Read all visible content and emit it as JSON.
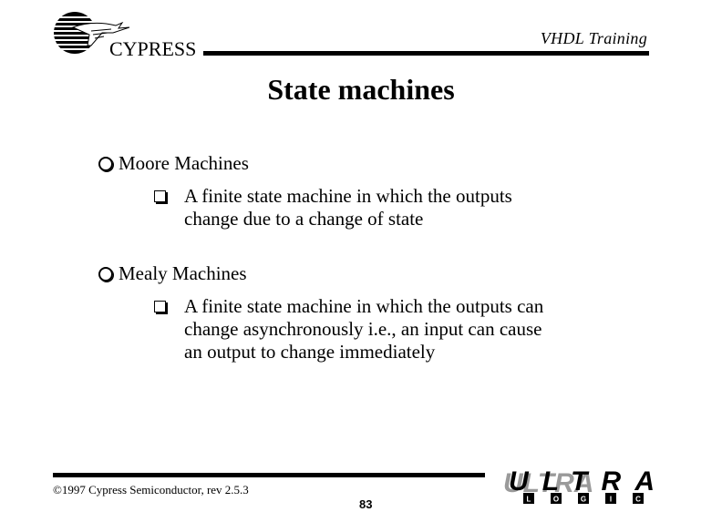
{
  "header": {
    "company_logo": "Cypress",
    "company_name": "CYPRESS",
    "title": "VHDL Training"
  },
  "slide": {
    "title": "State machines",
    "bullets": [
      {
        "label": "Moore Machines",
        "icon": "hollow-circle-bullet-icon",
        "sub": [
          {
            "icon": "hollow-square-bullet-icon",
            "lines": [
              "A finite state machine in which the outputs",
              "change due to a change of state"
            ]
          }
        ]
      },
      {
        "label": "Mealy Machines",
        "icon": "hollow-circle-bullet-icon",
        "sub": [
          {
            "icon": "hollow-square-bullet-icon",
            "lines": [
              "A finite state machine in which the outputs can",
              "change asynchronously i.e., an input can cause",
              "an output to change immediately"
            ]
          }
        ]
      }
    ]
  },
  "footer": {
    "copyright": "©1997 Cypress Semiconductor, rev 2.5.3",
    "page_number": "83",
    "brand_logo_top": "ULTRA",
    "brand_logo_letters": [
      "L",
      "O",
      "G",
      "I",
      "C"
    ]
  }
}
